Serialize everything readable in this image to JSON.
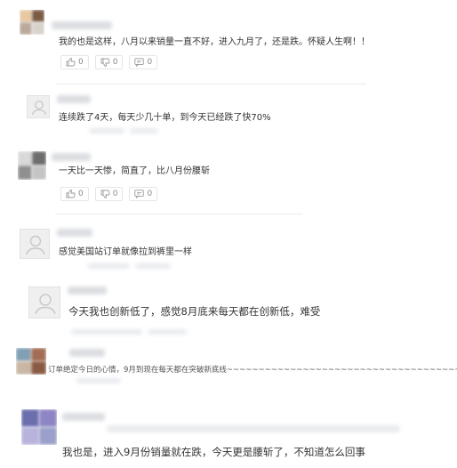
{
  "comments": [
    {
      "text": "我的也是这样，八月以来销量一直不好，进入九月了，还是跌。怀疑人生啊！！",
      "likes": "0",
      "dislikes": "0",
      "replies": "0"
    },
    {
      "text": "连续跌了4天，每天少几十单，到今天已经跌了快70%"
    },
    {
      "text": "一天比一天惨，简直了，比八月份腰斩",
      "likes": "0",
      "dislikes": "0",
      "replies": "0"
    },
    {
      "text": "感觉美国站订单就像拉到裤里一样"
    },
    {
      "text": "今天我也创新低了，感觉8月底来每天都在创新低，难受"
    },
    {
      "text": "订单绝定今日的心情，9月到现在每天都在突破新底线~~~~~~~~~~~~~~~~~~~~~~~~~~~~~~~~~~~~~~~"
    },
    {
      "text": "我也是，进入9月份销量就在跌，今天更是腰斩了，不知道怎么回事"
    }
  ],
  "icons": {
    "like": "thumbs-up-icon",
    "dislike": "thumbs-down-icon",
    "reply": "comment-icon",
    "avatar": "user-avatar-icon"
  },
  "colors": {
    "text": "#333333",
    "muted": "#888888",
    "border": "#e6e6e6"
  }
}
